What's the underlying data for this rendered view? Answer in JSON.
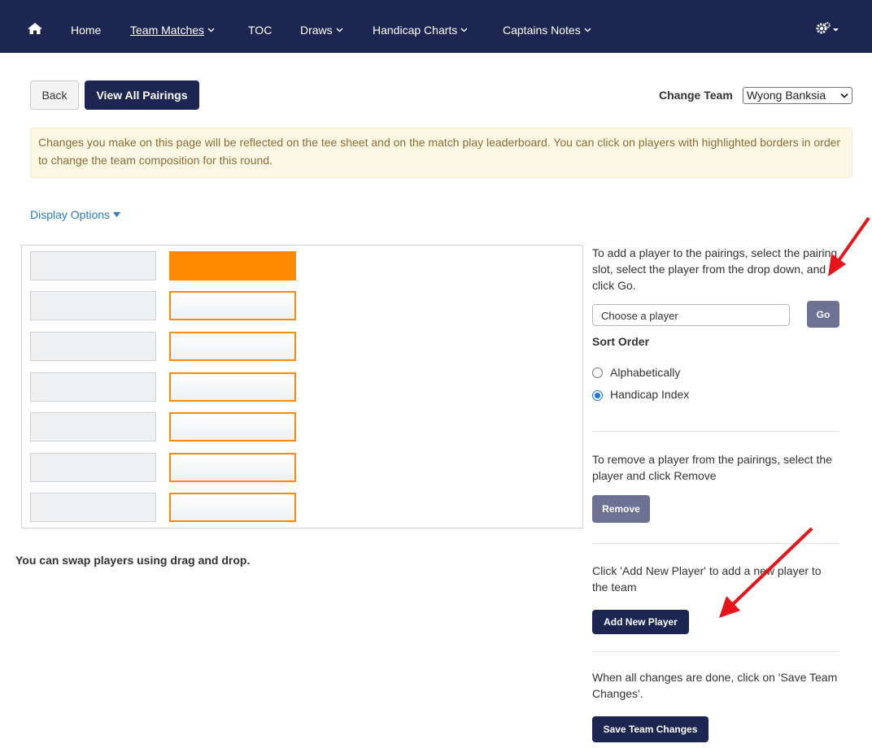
{
  "nav": {
    "items": [
      {
        "label": "Home",
        "has_dropdown": false
      },
      {
        "label": "Team Matches",
        "has_dropdown": true,
        "active": true
      },
      {
        "label": "TOC",
        "has_dropdown": false
      },
      {
        "label": "Draws",
        "has_dropdown": true
      },
      {
        "label": "Handicap Charts",
        "has_dropdown": true
      },
      {
        "label": "Captains Notes",
        "has_dropdown": true
      }
    ],
    "icons": {
      "home": "home-icon",
      "settings": "gears-icon"
    },
    "bg_color": "#1d2551"
  },
  "toolbar": {
    "back_label": "Back",
    "view_all_label": "View All Pairings",
    "change_team_label": "Change Team",
    "team_selected": "Wyong Banksia"
  },
  "alert": {
    "text": "Changes you make on this page will be reflected on the tee sheet and on the match play leaderboard. You can click on players with highlighted borders in order to change the team composition for this round."
  },
  "display_options_label": "Display Options",
  "pairings": {
    "rows": 7,
    "swap_text": "You can swap players using drag and drop."
  },
  "side": {
    "add_instructions": "To add a player to the pairings, select the pairing slot, select the player from the drop down, and click Go.",
    "player_placeholder": "Choose a player",
    "go_label": "Go",
    "sort_order_label": "Sort Order",
    "sort_options": [
      {
        "label": "Alphabetically",
        "checked": false
      },
      {
        "label": "Handicap Index",
        "checked": true
      }
    ],
    "remove_instructions": "To remove a player from the pairings, select the player and click Remove",
    "remove_label": "Remove",
    "add_new_instructions": "Click 'Add New Player' to add a new player to the team",
    "add_new_label": "Add New Player",
    "save_instructions": "When all changes are done, click on 'Save Team Changes'.",
    "save_label": "Save Team Changes"
  },
  "colors": {
    "accent_orange": "#ff8a00",
    "dark_button": "#1d2551",
    "muted_button": "#6d7294",
    "annotation_arrow": "#e8141b"
  }
}
